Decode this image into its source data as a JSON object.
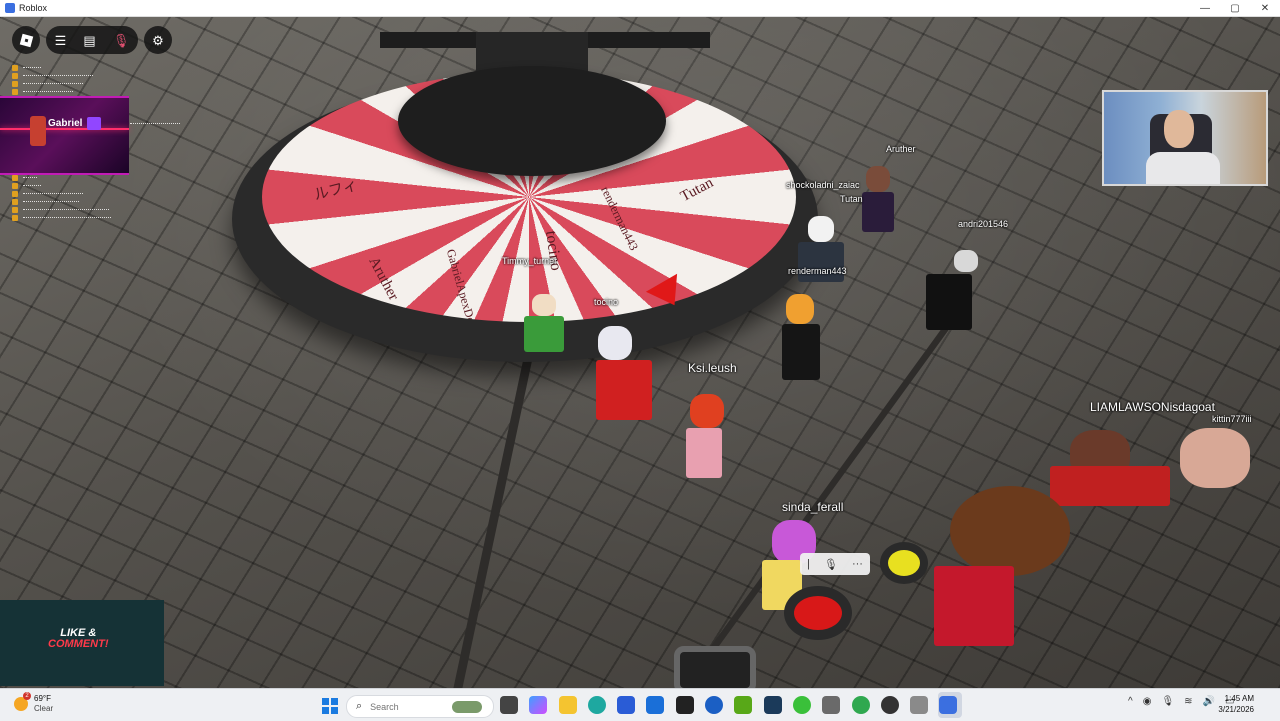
{
  "window": {
    "title": "Roblox",
    "minimize": "—",
    "maximize": "▢",
    "close": "✕"
  },
  "roblox_ui": {
    "home_icon": "roblox-logo-icon",
    "menu_icon": "hamburger-menu-icon",
    "chat_icon": "chat-icon",
    "mic_icon": "microphone-icon",
    "settings_icon": "gear-icon"
  },
  "wheel": {
    "names": [
      "Aruther",
      "GabrielApexDev",
      "tocino",
      "renderman443",
      "Tutan",
      "ルフィ"
    ]
  },
  "players": [
    {
      "name": "Aruther"
    },
    {
      "name": "shockoladni_zaiac"
    },
    {
      "name": "Tutan"
    },
    {
      "name": "andri201546"
    },
    {
      "name": "renderman443"
    },
    {
      "name": "Timmy_turner"
    },
    {
      "name": "tocino"
    },
    {
      "name": "Ksi.leush"
    },
    {
      "name": "LIAMLAWSONisdagoat"
    },
    {
      "name": "kittin777iii"
    },
    {
      "name": "sinda_ferall"
    }
  ],
  "overlays": {
    "twitch_name": "Gabriel",
    "like_line1": "LIKE &",
    "like_line2": "COMMENT!"
  },
  "voice_bar": {
    "mic": "🎙",
    "more": "···"
  },
  "taskbar": {
    "weather_temp": "69°F",
    "weather_desc": "Clear",
    "weather_badge": "2",
    "search_placeholder": "Search",
    "time": "1:45 AM",
    "date": "3/21/2026",
    "tray_expand": "^"
  },
  "colors": {
    "wheel_red": "#d94a5b",
    "wheel_white": "#f4f0ec",
    "pointer_red": "#e01818",
    "taskbar_bg": "#eef0f3",
    "twitch_purple": "#9146ff"
  }
}
